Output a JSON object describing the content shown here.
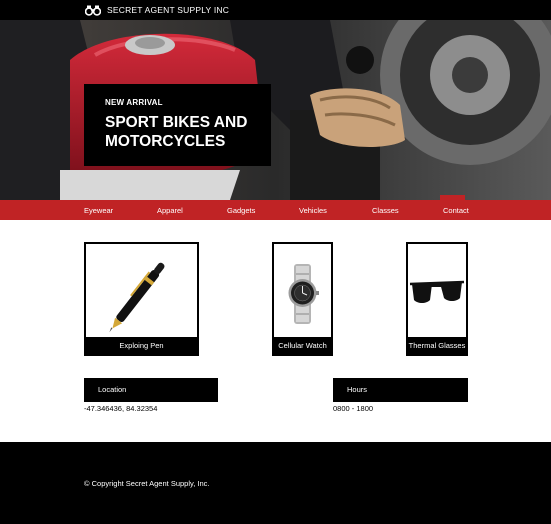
{
  "header": {
    "brand": "SECRET AGENT SUPPLY INC",
    "logo_icon": "binoculars-icon"
  },
  "hero": {
    "kicker": "NEW ARRIVAL",
    "title": "SPORT BIKES AND MOTORCYCLES"
  },
  "nav": {
    "items": [
      {
        "label": "Eyewear"
      },
      {
        "label": "Apparel"
      },
      {
        "label": "Gadgets"
      },
      {
        "label": "Vehicles"
      },
      {
        "label": "Classes"
      },
      {
        "label": "Contact"
      }
    ]
  },
  "products": [
    {
      "name": "Exploing Pen",
      "icon": "pen-icon"
    },
    {
      "name": "Cellular Watch",
      "icon": "watch-icon"
    },
    {
      "name": "Thermal Glasses",
      "icon": "sunglasses-icon"
    }
  ],
  "info": {
    "location_label": "Location",
    "location_value": "-47.346436, 84.32354",
    "hours_label": "Hours",
    "hours_value": "0800 - 1800"
  },
  "footer": {
    "copyright": "© Copyright Secret Agent Supply, Inc."
  },
  "colors": {
    "accent": "#c02325",
    "dark": "#000000"
  }
}
